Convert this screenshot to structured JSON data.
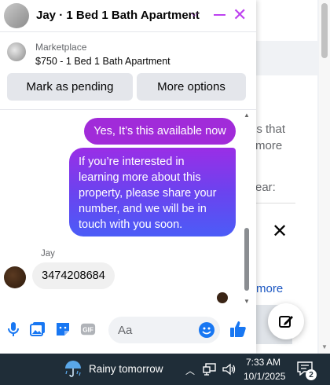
{
  "background": {
    "snippets": [
      "ds that",
      "more",
      "ear:"
    ],
    "link_text": "more"
  },
  "chat": {
    "title": "Jay · 1 Bed 1 Bath Apartment",
    "marketplace_label": "Marketplace",
    "listing": "$750 - 1 Bed 1 Bath Apartment",
    "buttons": {
      "mark_pending": "Mark as pending",
      "more_options": "More options"
    },
    "messages": [
      {
        "from": "me",
        "text": "Yes, It’s this available now"
      },
      {
        "from": "me",
        "text": "If you’re interested in learning more about this property, please share your number, and we will be in touch with you soon."
      },
      {
        "from": "Jay",
        "text": "3474208684"
      }
    ],
    "sender_name": "Jay",
    "composer_placeholder": "Aa",
    "accent_color": "#bd41f0"
  },
  "taskbar": {
    "weather": "Rainy tomorrow",
    "time": "7:33 AM",
    "date": "10/1/2025",
    "notification_count": "2"
  },
  "icons": [
    "chevron-down-icon",
    "minimize-icon",
    "close-icon",
    "mic-icon",
    "photo-icon",
    "sticker-icon",
    "gif-icon",
    "emoji-icon",
    "thumbs-up-icon",
    "compose-icon",
    "umbrella-rain-icon",
    "network-icon",
    "volume-icon",
    "notification-icon"
  ]
}
